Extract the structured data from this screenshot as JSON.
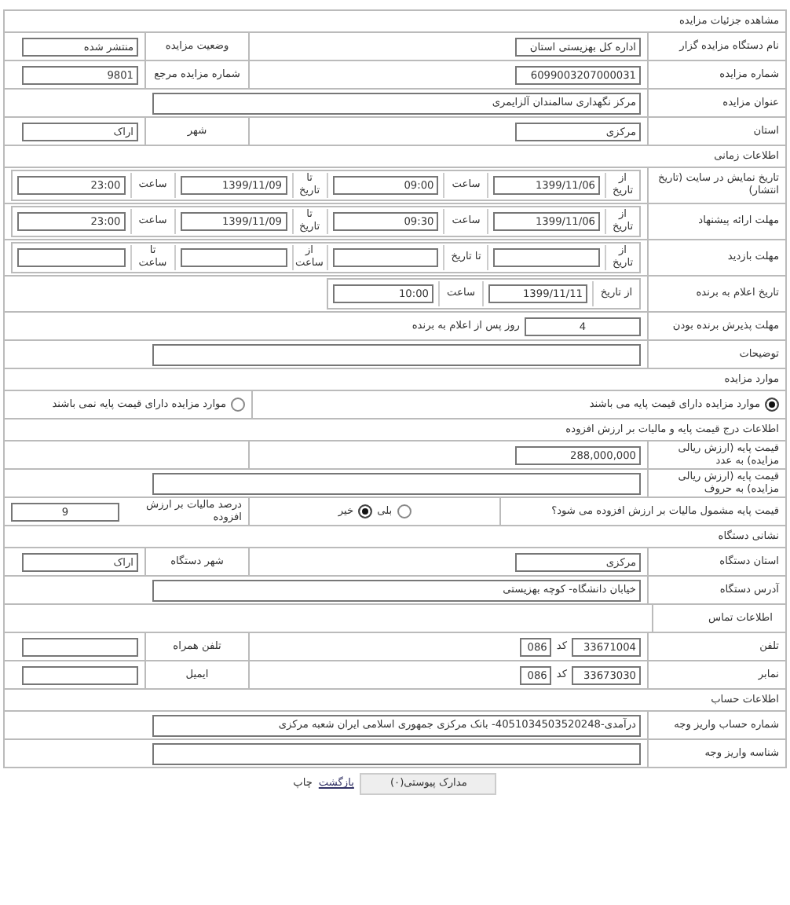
{
  "rows": [
    {
      "kind": "section",
      "text": "مشاهده جزئیات مزایده"
    },
    {
      "kind": "pair",
      "items": [
        {
          "label": "نام دستگاه مزایده گزار",
          "value": "اداره کل بهزیستی استان"
        },
        {
          "label": "وضعیت مزایده",
          "value": "منتشر شده"
        }
      ]
    },
    {
      "kind": "pair",
      "items": [
        {
          "label": "شماره مزایده",
          "value": "6099003207000031"
        },
        {
          "label": "شماره مزایده مرجع",
          "value": "9801"
        }
      ]
    },
    {
      "kind": "wide",
      "label": "عنوان مزایده",
      "value": "مرکز نگهداری سالمندان آلزایمری"
    },
    {
      "kind": "pair",
      "items": [
        {
          "label": "استان",
          "value": "مرکزی"
        },
        {
          "label": "شهر",
          "value": "اراک"
        }
      ]
    },
    {
      "kind": "section",
      "text": "اطلاعات زمانی"
    },
    {
      "kind": "schedule",
      "label": "تاریخ نمایش در سایت (تاریخ انتشار)",
      "parts": [
        {
          "caption": "از تاریخ",
          "value": "1399/11/06"
        },
        {
          "caption": "ساعت",
          "value": "09:00"
        },
        {
          "caption": "تا تاریخ",
          "value": "1399/11/09"
        },
        {
          "caption": "ساعت",
          "value": "23:00"
        }
      ]
    },
    {
      "kind": "schedule",
      "label": "مهلت ارائه پیشنهاد",
      "parts": [
        {
          "caption": "از تاریخ",
          "value": "1399/11/06"
        },
        {
          "caption": "ساعت",
          "value": "09:30"
        },
        {
          "caption": "تا تاریخ",
          "value": "1399/11/09"
        },
        {
          "caption": "ساعت",
          "value": "23:00"
        }
      ]
    },
    {
      "kind": "schedule",
      "label": "مهلت بازدید",
      "parts": [
        {
          "caption": "از تاریخ"
        },
        {
          "caption": "تا تاریخ"
        },
        {
          "caption": "از ساعت"
        },
        {
          "caption": "تا ساعت"
        }
      ]
    },
    {
      "kind": "schedule",
      "label": "تاریخ اعلام به برنده",
      "parts": [
        {
          "caption": "از تاریخ",
          "value": "1399/11/11"
        },
        {
          "caption": "ساعت",
          "value": "10:00"
        }
      ]
    },
    {
      "kind": "days",
      "label": "مهلت پذیرش برنده بودن",
      "value": "4",
      "suffix": "روز پس از اعلام به برنده"
    },
    {
      "kind": "wide",
      "label": "توضیحات"
    },
    {
      "kind": "section",
      "text": "موارد مزایده"
    },
    {
      "kind": "radios",
      "options": [
        {
          "label": "موارد مزایده دارای قیمت پایه می باشند",
          "selected": true
        },
        {
          "label": "موارد مزایده دارای قیمت پایه نمی باشند",
          "selected": false
        }
      ]
    },
    {
      "kind": "section",
      "text": "اطلاعات درج قیمت پایه و مالیات بر ارزش افزوده"
    },
    {
      "kind": "single",
      "label": "قیمت پایه (ارزش ریالی مزایده) به عدد",
      "value": "288,000,000"
    },
    {
      "kind": "wide",
      "label": "قیمت پایه (ارزش ریالی مزایده) به حروف"
    },
    {
      "kind": "vat",
      "label": "قیمت پایه مشمول مالیات بر ارزش افزوده می شود؟",
      "options": [
        {
          "label": "بلی",
          "selected": false
        },
        {
          "label": "خیر",
          "selected": true
        }
      ],
      "label2": "درصد مالیات بر ارزش افزوده",
      "value2": "9"
    },
    {
      "kind": "section",
      "text": "نشانی دستگاه"
    },
    {
      "kind": "pair",
      "items": [
        {
          "label": "استان دستگاه",
          "value": "مرکزی"
        },
        {
          "label": "شهر دستگاه",
          "value": "اراک"
        }
      ]
    },
    {
      "kind": "wide",
      "label": "آدرس دستگاه",
      "value": "خیابان دانشگاه- کوچه بهزیستی"
    },
    {
      "kind": "subsection",
      "text": "اطلاعات تماس"
    },
    {
      "kind": "phone",
      "label": "تلفن",
      "value": "33671004",
      "code_label": "کد",
      "code": "086",
      "label2": "تلفن همراه"
    },
    {
      "kind": "phone",
      "label": "نمابر",
      "value": "33673030",
      "code_label": "کد",
      "code": "086",
      "label2": "ایمیل"
    },
    {
      "kind": "section",
      "text": "اطلاعات حساب"
    },
    {
      "kind": "wide",
      "label": "شماره حساب واریز وجه",
      "value": "درآمدی-4051034503520248- بانک مرکزی جمهوری اسلامی ایران شعبه مرکزی"
    },
    {
      "kind": "wide",
      "label": "شناسه واریز وجه"
    }
  ],
  "footer": {
    "button": "مدارک پیوستی(۰)",
    "back": "بازگشت",
    "print": "چاپ"
  }
}
